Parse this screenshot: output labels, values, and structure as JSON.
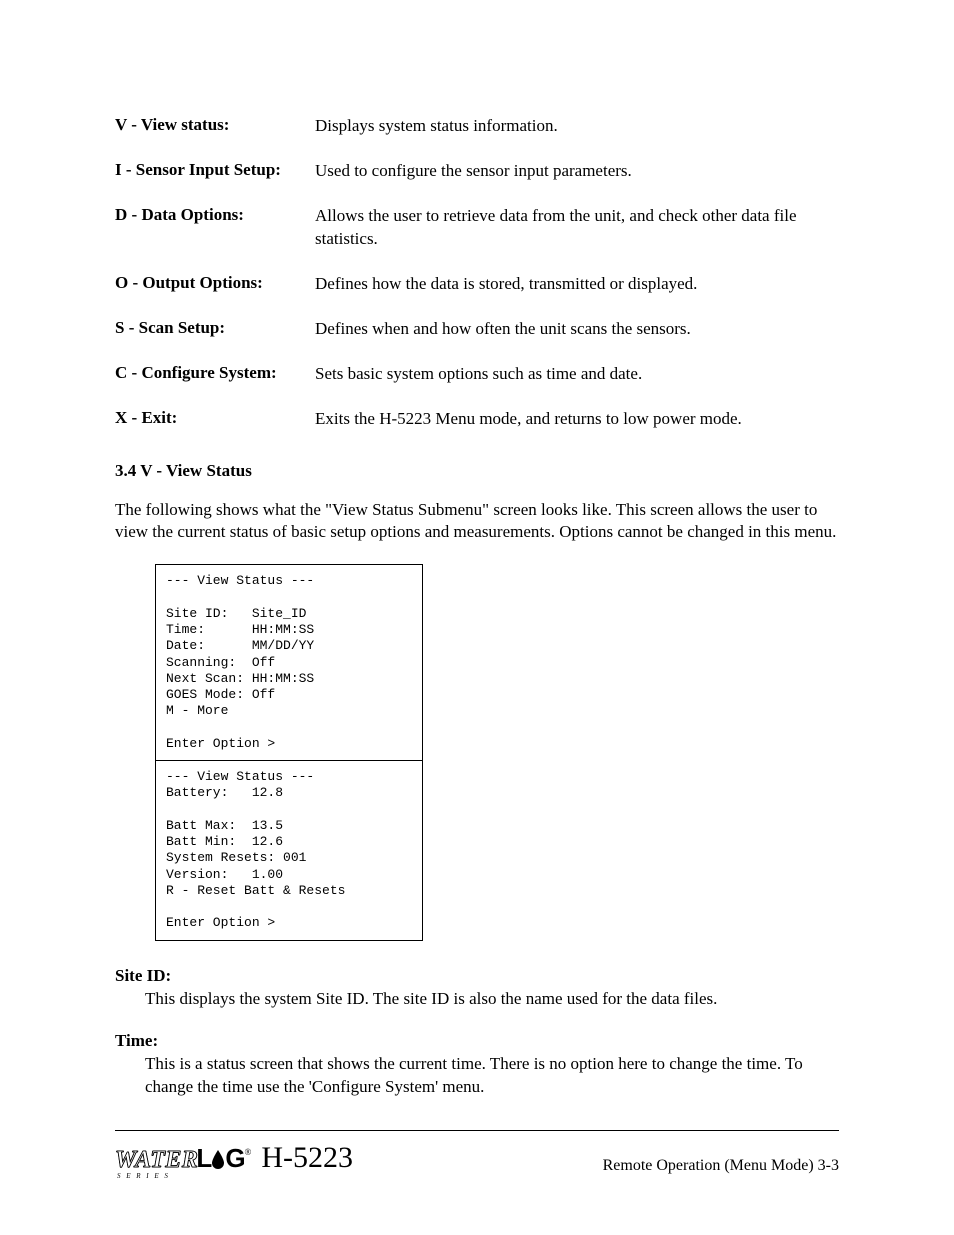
{
  "menu_items": [
    {
      "label": "V - View status:",
      "desc": "Displays system status information."
    },
    {
      "label": "I - Sensor Input Setup:",
      "desc": "Used to configure the sensor input parameters."
    },
    {
      "label": "D - Data Options:",
      "desc": "Allows the user to retrieve data from the unit, and check other data file statistics."
    },
    {
      "label": "O - Output Options:",
      "desc": "Defines how the data is stored, transmitted or displayed."
    },
    {
      "label": "S - Scan Setup:",
      "desc": "Defines when and how often the unit scans the sensors."
    },
    {
      "label": "C - Configure System:",
      "desc": "Sets basic system options such as time and date."
    },
    {
      "label": "X - Exit:",
      "desc": "Exits the H-5223 Menu mode, and returns to low power mode."
    }
  ],
  "section": {
    "heading": "3.4  V - View Status",
    "intro": "The following shows what the \"View Status Submenu\" screen looks like. This screen allows the user to view the current status of basic setup options and measurements.  Options cannot be changed in this menu."
  },
  "status_box_1": "--- View Status ---\n\nSite ID:   Site_ID\nTime:      HH:MM:SS\nDate:      MM/DD/YY\nScanning:  Off\nNext Scan: HH:MM:SS\nGOES Mode: Off\nM - More\n\nEnter Option >",
  "status_box_2": "--- View Status ---\nBattery:   12.8\n\nBatt Max:  13.5\nBatt Min:  12.6\nSystem Resets: 001\nVersion:   1.00\nR - Reset Batt & Resets\n\nEnter Option >",
  "fields": [
    {
      "label": "Site ID:",
      "desc": "This displays the system Site ID.  The site ID is also the name used for the data files."
    },
    {
      "label": "Time:",
      "desc": "This is a status screen that shows the current time.  There is no option here to change the time.  To change the time use the 'Configure System' menu."
    }
  ],
  "footer": {
    "model": "H-5223",
    "right": "Remote Operation (Menu Mode)  3-3",
    "logo_water": "WATER",
    "logo_l": "L",
    "logo_g": "G",
    "logo_series": "S E R I E S",
    "reg": "®"
  }
}
